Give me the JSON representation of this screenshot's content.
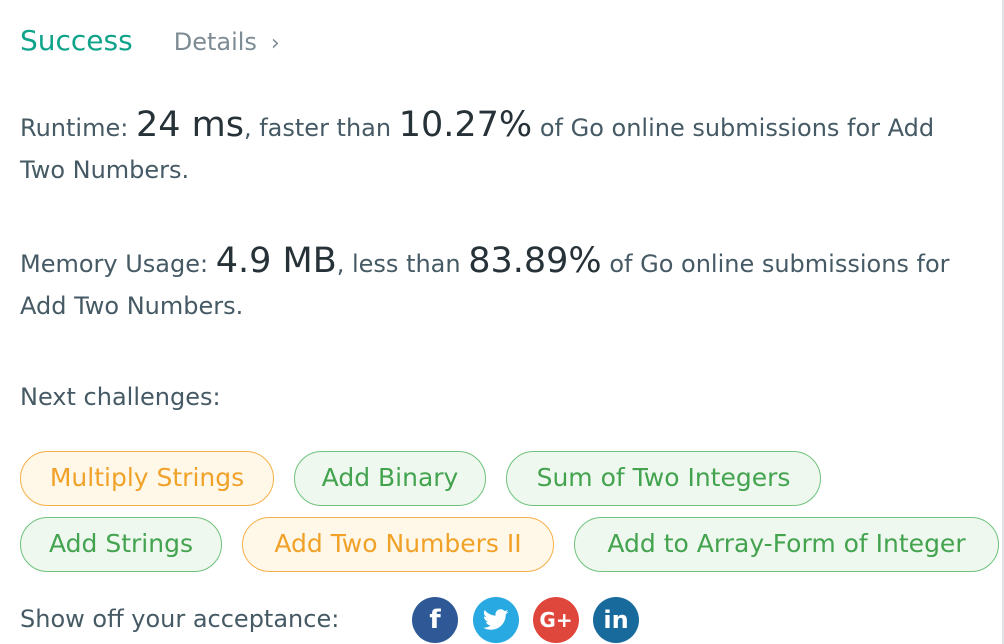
{
  "header": {
    "status": "Success",
    "details_label": "Details",
    "details_chevron": "›"
  },
  "runtime": {
    "label": "Runtime: ",
    "value": "24 ms",
    "comparison": ", faster than ",
    "percent": "10.27%",
    "suffix_line1": " of Go online submissions for Add",
    "suffix_line2": "Two Numbers."
  },
  "memory": {
    "label": "Memory Usage: ",
    "value": "4.9 MB",
    "comparison": ", less than ",
    "percent": "83.89%",
    "suffix_line1": " of Go online submissions for",
    "suffix_line2": "Add Two Numbers."
  },
  "next_challenges": {
    "label": "Next challenges:",
    "items": [
      {
        "label": "Multiply Strings",
        "difficulty": "medium",
        "color": "#f0a228"
      },
      {
        "label": "Add Binary",
        "difficulty": "easy",
        "color": "#43a34f"
      },
      {
        "label": "Sum of Two Integers",
        "difficulty": "easy",
        "color": "#43a34f"
      },
      {
        "label": "Add Strings",
        "difficulty": "easy",
        "color": "#43a34f"
      },
      {
        "label": "Add Two Numbers II",
        "difficulty": "medium",
        "color": "#f0a228"
      },
      {
        "label": "Add to Array-Form of Integer",
        "difficulty": "easy",
        "color": "#43a34f"
      }
    ]
  },
  "share": {
    "label": "Show off your acceptance:",
    "buttons": [
      {
        "icon": "facebook-icon",
        "glyph": "f",
        "color": "#2f5897"
      },
      {
        "icon": "twitter-icon",
        "glyph": "",
        "color": "#29a9e1"
      },
      {
        "icon": "google-plus-icon",
        "glyph": "G+",
        "color": "#e0473c"
      },
      {
        "icon": "linkedin-icon",
        "glyph": "in",
        "color": "#186a9c"
      }
    ]
  },
  "colors": {
    "success": "#0fa38a",
    "text": "#455a64",
    "muted": "#7c8b94"
  }
}
